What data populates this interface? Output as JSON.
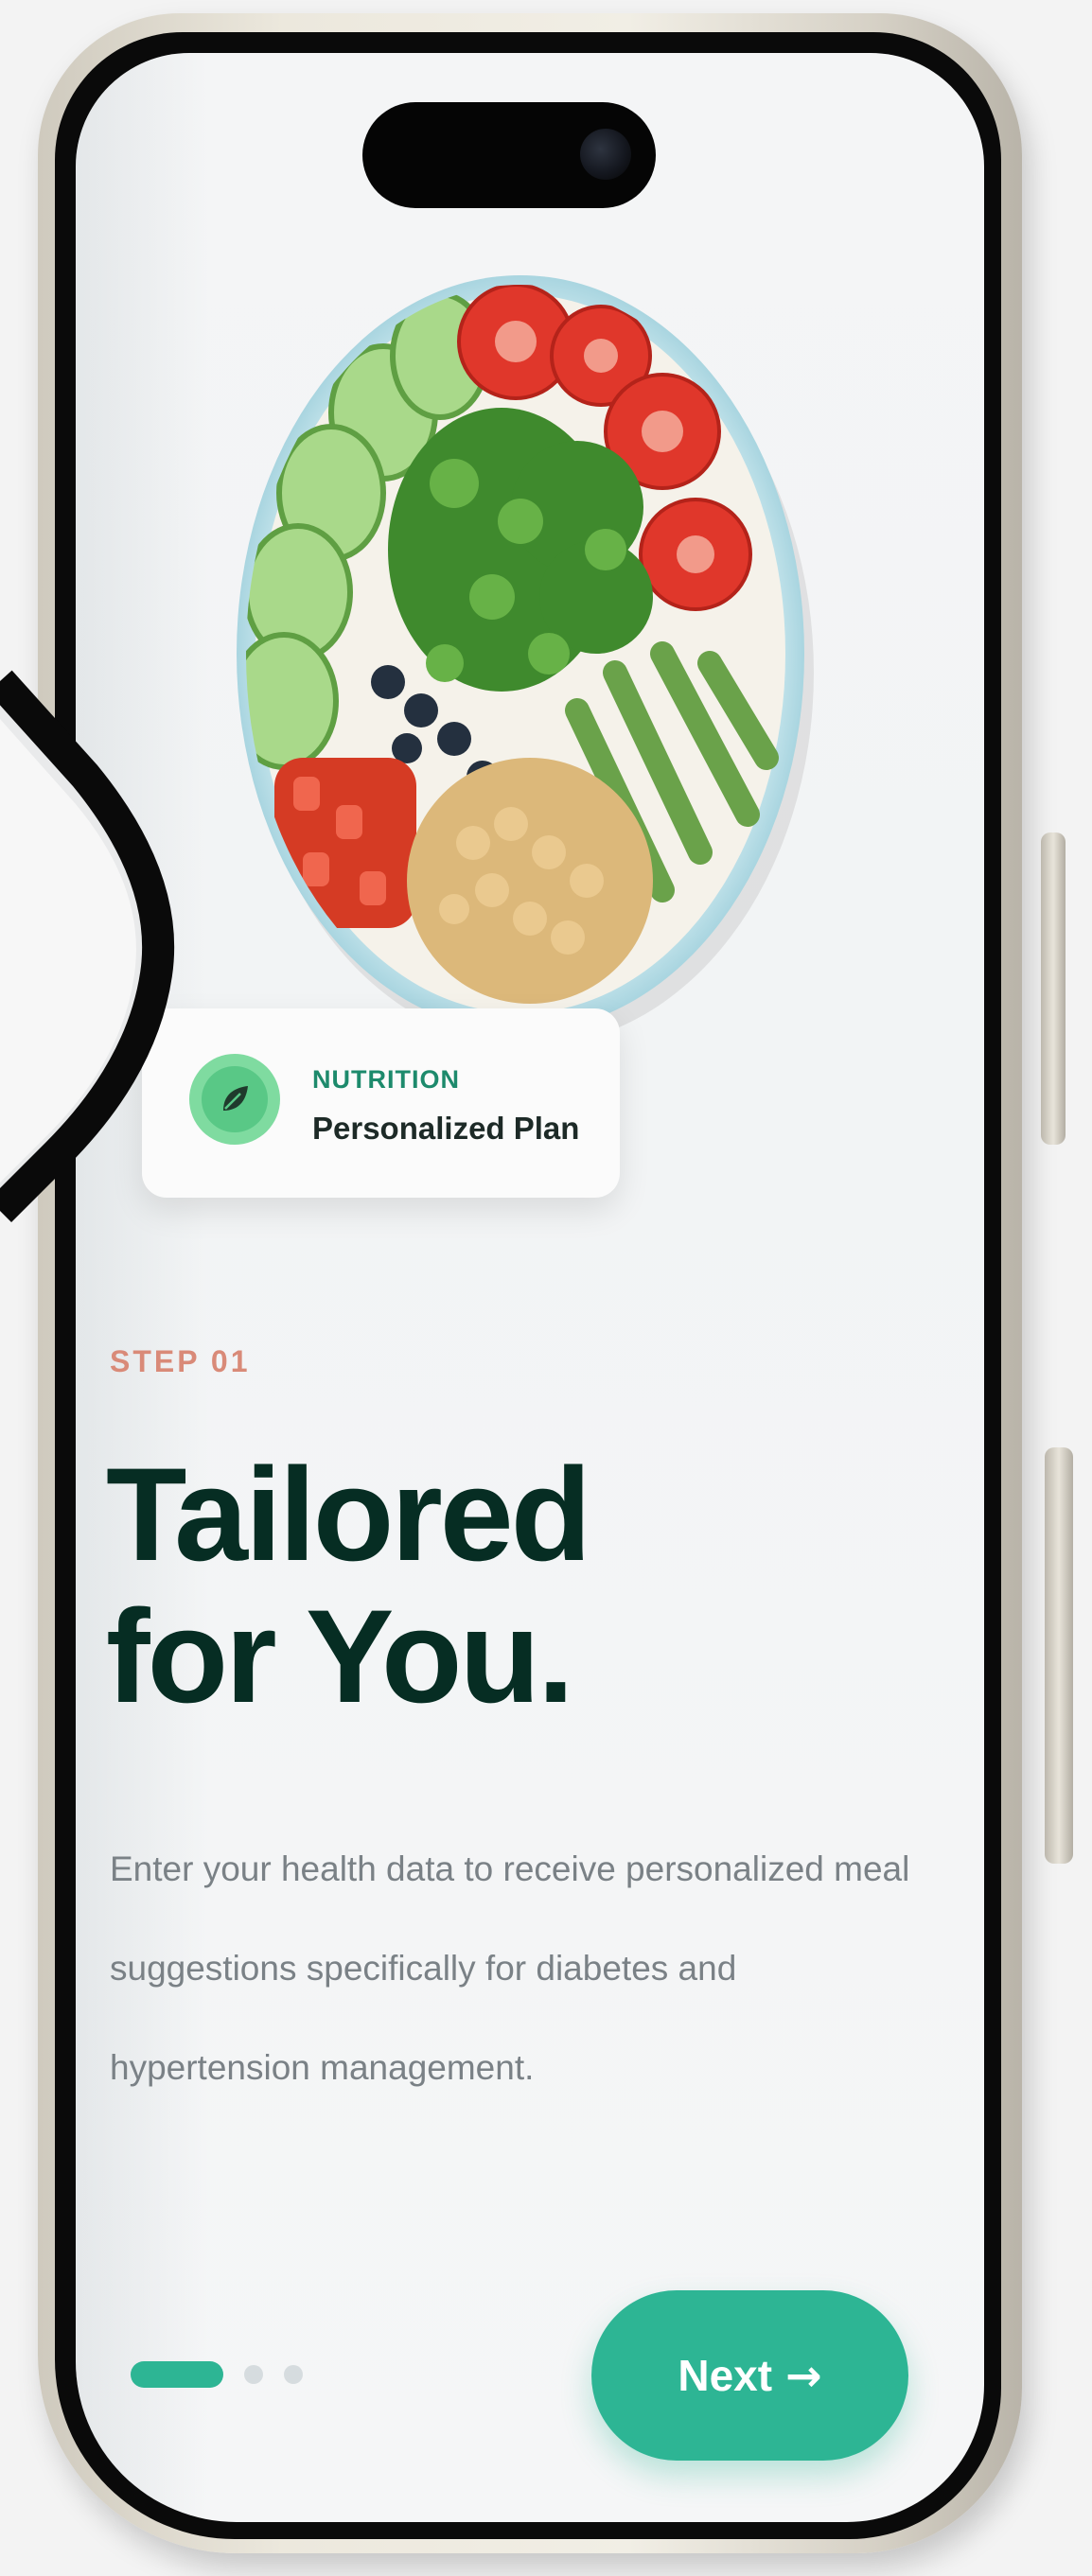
{
  "badge": {
    "category": "NUTRITION",
    "label": "Personalized Plan"
  },
  "onboarding": {
    "step": "STEP 01",
    "headline_line1": "Tailored",
    "headline_line2": "for You.",
    "description": "Enter your health data to receive personalized meal suggestions specifically for diabetes and hypertension management."
  },
  "pager": {
    "total": 3,
    "active_index": 0
  },
  "actions": {
    "next_label": "Next",
    "next_icon": "arrow-right-icon"
  },
  "colors": {
    "accent": "#2db594",
    "step_label": "#d98a78",
    "headline": "#062d23",
    "badge_category": "#1d8a6c"
  }
}
